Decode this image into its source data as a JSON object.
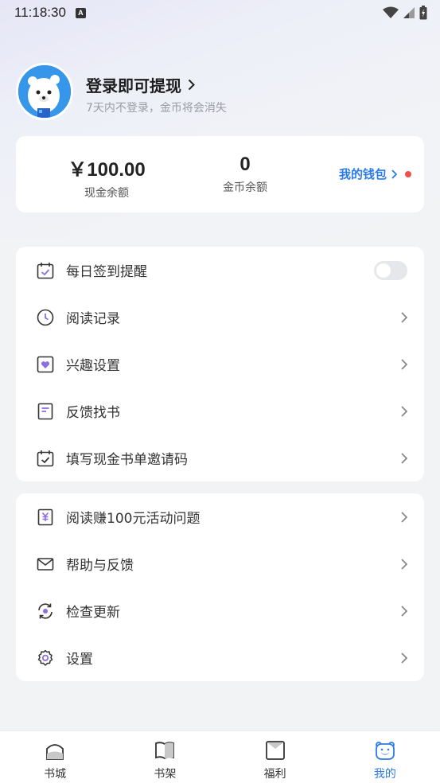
{
  "status_bar": {
    "time": "11:18:30",
    "badge": "A"
  },
  "profile": {
    "title": "登录即可提现",
    "subtitle": "7天内不登录，金币将会消失"
  },
  "wallet": {
    "cash_value": "￥100.00",
    "cash_label": "现金余额",
    "coin_value": "0",
    "coin_label": "金币余额",
    "link_label": "我的钱包"
  },
  "menu_group_1": [
    {
      "label": "每日签到提醒",
      "icon": "calendar-check-icon",
      "toggle": false
    },
    {
      "label": "阅读记录",
      "icon": "clock-icon"
    },
    {
      "label": "兴趣设置",
      "icon": "heart-icon"
    },
    {
      "label": "反馈找书",
      "icon": "book-icon"
    },
    {
      "label": "填写现金书单邀请码",
      "icon": "calendar-icon"
    }
  ],
  "menu_group_2": [
    {
      "label": "阅读赚100元活动问题",
      "icon": "yuan-icon"
    },
    {
      "label": "帮助与反馈",
      "icon": "mail-icon"
    },
    {
      "label": "检查更新",
      "icon": "refresh-icon"
    },
    {
      "label": "设置",
      "icon": "gear-icon"
    }
  ],
  "tabs": [
    {
      "label": "书城",
      "icon": "store-icon"
    },
    {
      "label": "书架",
      "icon": "bookshelf-icon"
    },
    {
      "label": "福利",
      "icon": "gift-icon"
    },
    {
      "label": "我的",
      "icon": "bear-icon",
      "active": true
    }
  ],
  "colors": {
    "accent": "#2b7be9",
    "icon_purple": "#8a6fe0",
    "red_dot": "#f0504a"
  }
}
